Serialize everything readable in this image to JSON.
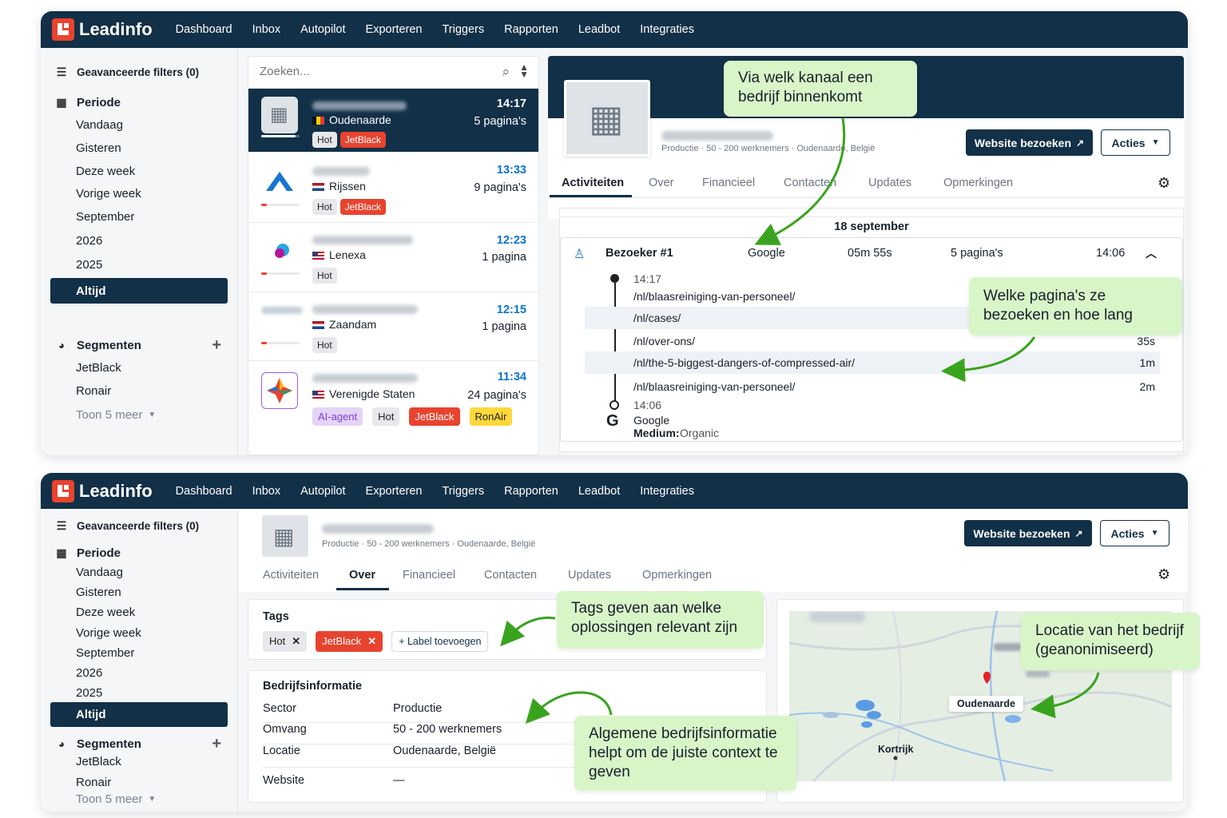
{
  "app": {
    "name": "Leadinfo"
  },
  "nav": [
    "Dashboard",
    "Inbox",
    "Autopilot",
    "Exporteren",
    "Triggers",
    "Rapporten",
    "Leadbot",
    "Integraties"
  ],
  "sidebar": {
    "filters": "Geavanceerde filters (0)",
    "period_title": "Periode",
    "period_items": [
      "Vandaag",
      "Gisteren",
      "Deze week",
      "Vorige week",
      "September",
      "2026",
      "2025"
    ],
    "active_period": "Altijd",
    "segments_title": "Segmenten",
    "segments": [
      "JetBlack",
      "Ronair"
    ],
    "show_more": "Toon 5 meer"
  },
  "search": {
    "placeholder": "Zoeken..."
  },
  "leads": [
    {
      "city": "Oudenaarde",
      "time": "14:17",
      "pages": "5 pagina's",
      "tags": [
        "Hot",
        "JetBlack"
      ],
      "progress": 0.9
    },
    {
      "city": "Rijssen",
      "time": "13:33",
      "pages": "9 pagina's",
      "tags": [
        "Hot",
        "JetBlack"
      ],
      "progress": 0.15
    },
    {
      "city": "Lenexa",
      "time": "12:23",
      "pages": "1 pagina",
      "tags": [
        "Hot"
      ],
      "progress": 0.15
    },
    {
      "city": "Zaandam",
      "time": "12:15",
      "pages": "1 pagina",
      "tags": [
        "Hot"
      ],
      "progress": 0.15
    },
    {
      "city": "Verenigde Staten",
      "time": "11:34",
      "pages": "24 pagina's",
      "tags": [
        "AI-agent",
        "Hot",
        "JetBlack",
        "RonAir"
      ]
    }
  ],
  "company": {
    "meta": "Productie · 50 - 200 werknemers · Oudenaarde, België",
    "visit_button": "Website bezoeken",
    "actions_button": "Acties",
    "tabs": [
      "Activiteiten",
      "Over",
      "Financieel",
      "Contacten",
      "Updates",
      "Opmerkingen"
    ]
  },
  "activity": {
    "date": "18 september",
    "visitor": "Bezoeker #1",
    "source": "Google",
    "duration": "05m 55s",
    "pages": "5 pagina's",
    "time": "14:06",
    "start_time": "14:17",
    "visits": [
      {
        "url": "/nl/blaasreiniging-van-personeel/",
        "dur": ""
      },
      {
        "url": "/nl/cases/",
        "dur": ""
      },
      {
        "url": "/nl/over-ons/",
        "dur": "35s"
      },
      {
        "url": "/nl/the-5-biggest-dangers-of-compressed-air/",
        "dur": "1m"
      },
      {
        "url": "/nl/blaasreiniging-van-personeel/",
        "dur": "2m"
      }
    ],
    "end_time": "14:06",
    "end_source": "Google",
    "medium_label": "Medium:",
    "medium_value": "Organic"
  },
  "tags_card": {
    "title": "Tags",
    "tags": [
      "Hot",
      "JetBlack"
    ],
    "add_label": "+ Label toevoegen"
  },
  "company_info": {
    "title": "Bedrijfsinformatie",
    "rows": [
      {
        "label": "Sector",
        "value": "Productie"
      },
      {
        "label": "Omvang",
        "value": "50 - 200 werknemers"
      },
      {
        "label": "Locatie",
        "value": "Oudenaarde, België"
      },
      {
        "label": "Website",
        "value": "—"
      }
    ]
  },
  "map": {
    "city_label": "Oudenaarde",
    "other_city": "Kortrijk"
  },
  "callouts": {
    "channel": "Via welk kanaal een bedrijf binnenkomt",
    "pages": "Welke pagina's ze bezoeken en hoe lang",
    "tags": "Tags geven aan welke oplossingen relevant zijn",
    "location": "Locatie van het bedrijf (geanonimiseerd)",
    "info": "Algemene bedrijfsinformatie helpt om de juiste context te geven"
  },
  "colors": {
    "navy": "#123047",
    "brand_red": "#e8432e",
    "link_blue": "#0b74c9",
    "callout_green": "#d8f5c8",
    "arrow_green": "#3aa31e"
  }
}
